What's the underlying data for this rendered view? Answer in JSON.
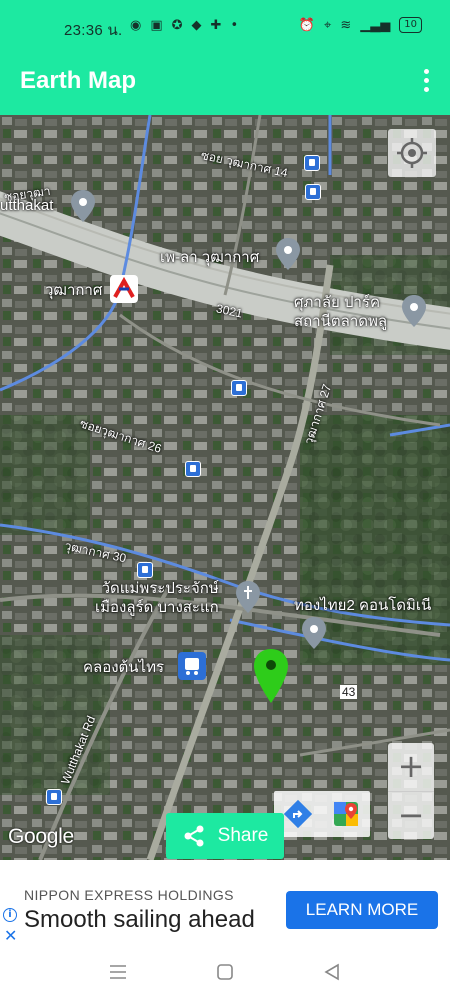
{
  "status_bar": {
    "time": "23:36 น.",
    "battery": "10"
  },
  "app_bar": {
    "title": "Earth Map"
  },
  "map": {
    "labels": {
      "wutthakat": "utthakat",
      "soi_wutthakat_top": "ซอยวุฒา",
      "soi_wutthakat_14": "ซอย วุฒากาศ 14",
      "wutthakat_station": "วุฒากาศ",
      "phe_la_wutthakat": "เพ-ลา วุฒากาศ",
      "road_3021": "3021",
      "university": "ศุภาลัย ปาร์ค\nสถานีตลาดพลู",
      "soi_26": "ซอยวุฒากาศ 26",
      "wutthakat_277": "วุฒากาศ 27",
      "wutthakat_30": "วุฒากาศ 30",
      "temple": "วัดแม่พระประจักษ์\nเมืองลูร์ด บางสะแก",
      "thongthai": "ทองไทย2 คอนโดมิเนี",
      "khlong_ton_sai": "คลองต้นไทร",
      "route_43": "43",
      "wutthakat_rd": "Wutthakat Rd"
    },
    "google": "Google",
    "share_label": "Share"
  },
  "ad": {
    "sponsor": "NIPPON EXPRESS HOLDINGS",
    "headline": "Smooth sailing ahead",
    "cta": "LEARN MORE"
  },
  "colors": {
    "accent": "#1de9a1",
    "ad_button": "#1a73e8",
    "pin_green": "#2ecc1a"
  }
}
